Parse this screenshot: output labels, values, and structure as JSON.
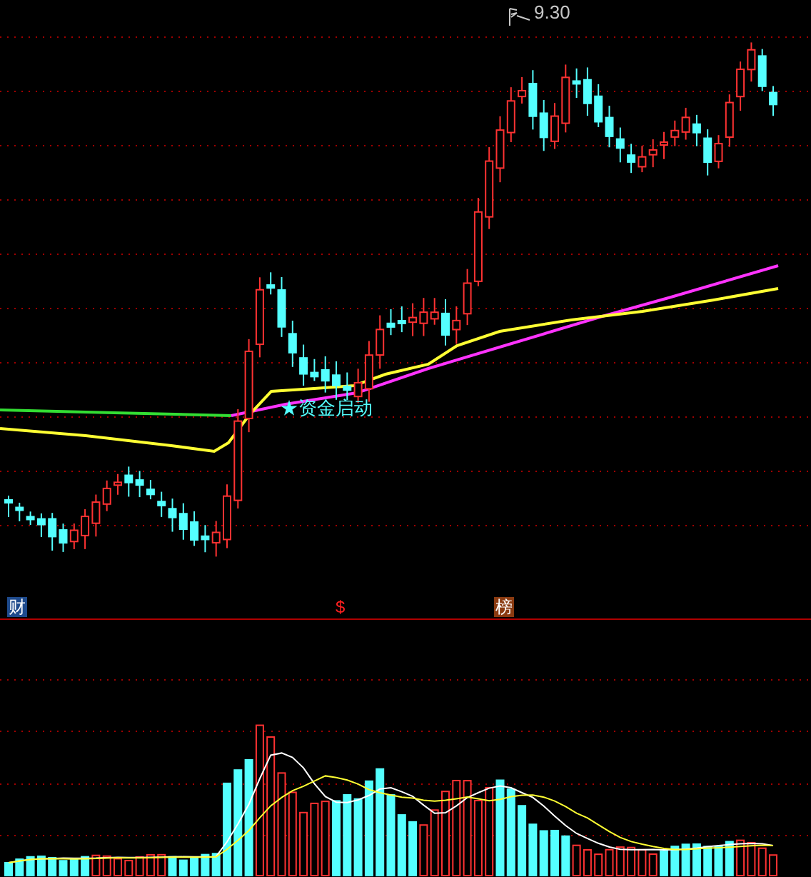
{
  "price_panel": {
    "high_marker": "9.30",
    "signal_label": "★资金启动"
  },
  "indicator_bar": {
    "badges": [
      {
        "text": "财",
        "kind": "finance"
      },
      {
        "text": "$",
        "kind": "dollar"
      },
      {
        "text": "榜",
        "kind": "ranking"
      }
    ]
  }
}
